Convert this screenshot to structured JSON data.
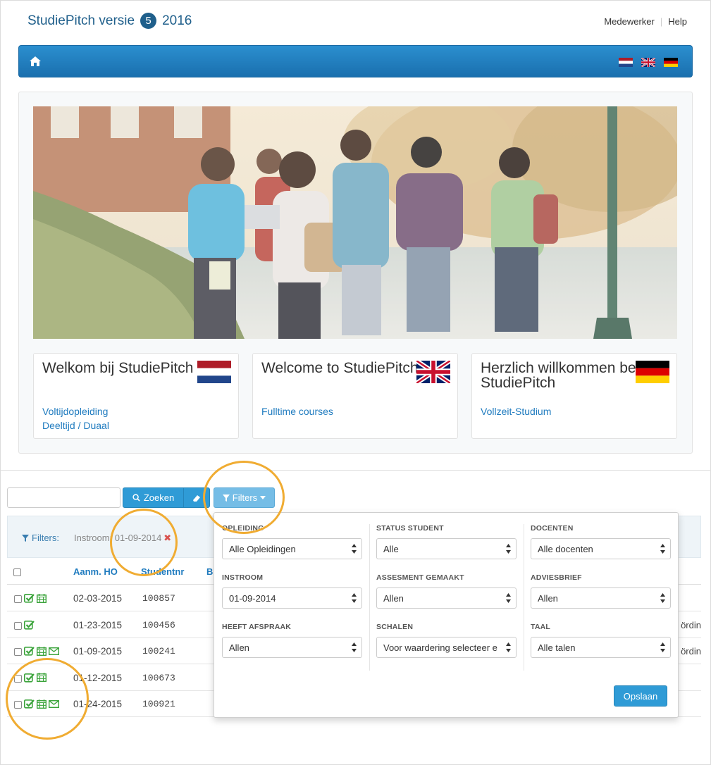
{
  "header": {
    "app_name": "StudiePitch versie",
    "version": "5",
    "year": "2016",
    "links": [
      "Medewerker",
      "Help"
    ]
  },
  "navbar": {
    "home_icon": "home-icon",
    "languages": [
      "nl",
      "en",
      "de"
    ]
  },
  "welcome_cards": [
    {
      "title": "Welkom bij StudiePitch",
      "flag": "nl",
      "links": [
        "Voltijdopleiding",
        "Deeltijd / Duaal"
      ]
    },
    {
      "title": "Welcome to StudiePitch",
      "flag": "en",
      "links": [
        "Fulltime courses"
      ]
    },
    {
      "title": "Herzlich willkommen bei StudiePitch",
      "flag": "de",
      "links": [
        "Vollzeit-Studium"
      ]
    }
  ],
  "toolbar": {
    "search_value": "",
    "search_label": "Zoeken",
    "filters_label": "Filters"
  },
  "active_filters": {
    "label": "Filters:",
    "tag": "Instroom: 01-09-2014"
  },
  "table": {
    "headers": [
      "Aanm. HO",
      "Studentnr",
      "B"
    ],
    "rows": [
      {
        "date": "02-03-2015",
        "studentnr": "100857",
        "icons": [
          "check-icon",
          "calendar-icon"
        ],
        "extra": ""
      },
      {
        "date": "01-23-2015",
        "studentnr": "100456",
        "icons": [
          "check-icon"
        ],
        "extra": "ördin"
      },
      {
        "date": "01-09-2015",
        "studentnr": "100241",
        "icons": [
          "check-icon",
          "calendar-icon",
          "mail-icon"
        ],
        "extra": "ördin"
      },
      {
        "date": "01-12-2015",
        "studentnr": "100673",
        "icons": [
          "check-icon",
          "calendar-icon"
        ],
        "extra": ""
      },
      {
        "date": "01-24-2015",
        "studentnr": "100921",
        "icons": [
          "check-icon",
          "calendar-icon",
          "mail-icon"
        ],
        "extra": ""
      }
    ]
  },
  "filter_panel": {
    "columns": [
      [
        {
          "label": "Opleiding",
          "value": "Alle Opleidingen"
        },
        {
          "label": "Instroom",
          "value": "01-09-2014"
        },
        {
          "label": "Heeft afspraak",
          "value": "Allen"
        }
      ],
      [
        {
          "label": "Status student",
          "value": "Alle"
        },
        {
          "label": "Assesment gemaakt",
          "value": "Allen"
        },
        {
          "label": "Schalen",
          "value": "Voor waardering selecteer e"
        }
      ],
      [
        {
          "label": "Docenten",
          "value": "Alle docenten"
        },
        {
          "label": "Adviesbrief",
          "value": "Allen"
        },
        {
          "label": "Taal",
          "value": "Alle talen"
        }
      ]
    ],
    "save_label": "Opslaan"
  },
  "colors": {
    "brand": "#1f5f8b",
    "primary_button": "#2f9bd6",
    "link": "#1f7bbf",
    "success_icon": "#3aa33a",
    "callout": "#f0ac32",
    "remove": "#d9534f"
  }
}
